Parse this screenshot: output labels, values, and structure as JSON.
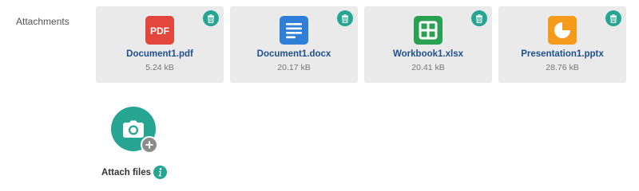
{
  "attachments_label": "Attachments",
  "accent_color": "#26a592",
  "files": [
    {
      "name": "Document1.pdf",
      "size": "5.24 kB",
      "icon": "pdf-file-icon",
      "badge": "PDF",
      "color": "#e3463c"
    },
    {
      "name": "Document1.docx",
      "size": "20.17 kB",
      "icon": "word-document-icon",
      "color": "#2f7fd8"
    },
    {
      "name": "Workbook1.xlsx",
      "size": "20.41 kB",
      "icon": "spreadsheet-icon",
      "color": "#2aa152"
    },
    {
      "name": "Presentation1.pptx",
      "size": "28.76 kB",
      "icon": "presentation-icon",
      "color": "#f59a1b"
    }
  ],
  "attach": {
    "label": "Attach files",
    "icon": "camera-add-icon",
    "info_icon": "info-icon"
  }
}
